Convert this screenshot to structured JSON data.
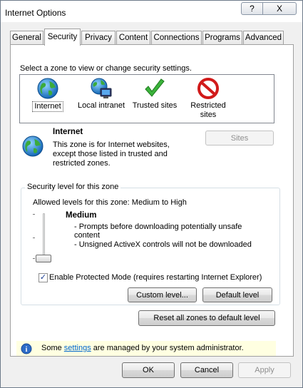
{
  "window": {
    "title": "Internet Options",
    "help_label": "?",
    "close_label": "X"
  },
  "tabs": [
    {
      "label": "General"
    },
    {
      "label": "Security"
    },
    {
      "label": "Privacy"
    },
    {
      "label": "Content"
    },
    {
      "label": "Connections"
    },
    {
      "label": "Programs"
    },
    {
      "label": "Advanced"
    }
  ],
  "active_tab": "Security",
  "zones_prompt": "Select a zone to view or change security settings.",
  "zones": [
    {
      "label": "Internet",
      "icon": "globe-icon"
    },
    {
      "label": "Local intranet",
      "icon": "intranet-icon"
    },
    {
      "label": "Trusted sites",
      "icon": "checkmark-icon"
    },
    {
      "label": "Restricted sites",
      "icon": "restricted-icon"
    }
  ],
  "selected_zone": {
    "title": "Internet",
    "desc_line1": "This zone is for Internet websites,",
    "desc_line2": "except those listed in trusted and",
    "desc_line3": "restricted zones.",
    "sites_label": "Sites"
  },
  "security_level": {
    "group_title": "Security level for this zone",
    "allowed": "Allowed levels for this zone: Medium to High",
    "level_name": "Medium",
    "bullet1a": "- Prompts before downloading potentially unsafe",
    "bullet1b": "content",
    "bullet2": "- Unsigned ActiveX controls will not be downloaded",
    "protected_mode_checked": true,
    "protected_mode_check_glyph": "✓",
    "protected_mode_label": "Enable Protected Mode (requires restarting Internet Explorer)",
    "custom_level_label": "Custom level...",
    "default_level_label": "Default level"
  },
  "reset_all_label": "Reset all zones to default level",
  "info_bar": {
    "prefix": "Some ",
    "link": "settings",
    "suffix": " are managed by your system administrator.",
    "icon_glyph": "i"
  },
  "footer": {
    "ok_label": "OK",
    "cancel_label": "Cancel",
    "apply_label": "Apply"
  }
}
